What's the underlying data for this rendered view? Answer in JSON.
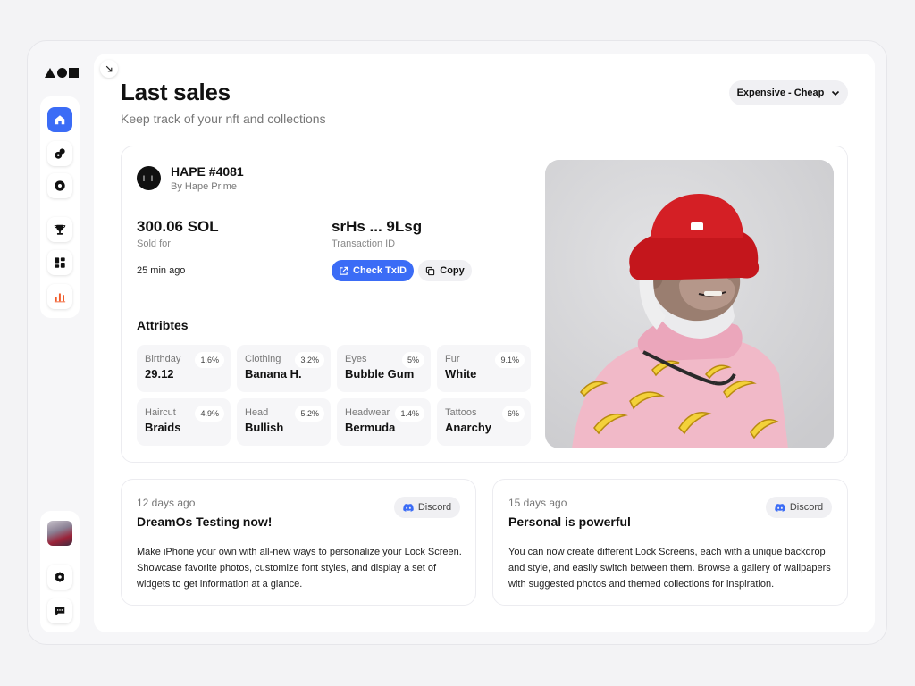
{
  "header": {
    "title": "Last sales",
    "subtitle": "Keep track of your nft and collections",
    "sort": {
      "selected": "Expensive - Cheap"
    }
  },
  "sidebar": {
    "items": [
      {
        "icon": "home-icon",
        "active": true
      },
      {
        "icon": "coins-icon",
        "active": false
      },
      {
        "icon": "disc-icon",
        "active": false
      },
      {
        "icon": "trophy-icon",
        "active": false
      },
      {
        "icon": "dashboard-icon",
        "active": false
      },
      {
        "icon": "bar-chart-icon",
        "active": false
      }
    ],
    "bottom": [
      {
        "icon": "avatar"
      },
      {
        "icon": "hexagon-settings-icon"
      },
      {
        "icon": "chat-icon"
      }
    ]
  },
  "sale": {
    "collection_logo": "I I",
    "name": "HAPE #4081",
    "by": "By Hape Prime",
    "price": "300.06 SOL",
    "price_label": "Sold for",
    "time_ago": "25 min ago",
    "tx_id": "srHs ... 9Lsg",
    "tx_label": "Transaction ID",
    "check_label": "Check TxID",
    "copy_label": "Copy",
    "attributes_heading": "Attribtes",
    "attributes": [
      {
        "name": "Birthday",
        "value": "29.12",
        "pct": "1.6%"
      },
      {
        "name": "Clothing",
        "value": "Banana H.",
        "pct": "3.2%"
      },
      {
        "name": "Eyes",
        "value": "Bubble Gum",
        "pct": "5%"
      },
      {
        "name": "Fur",
        "value": "White",
        "pct": "9.1%"
      },
      {
        "name": "Haircut",
        "value": "Braids",
        "pct": "4.9%"
      },
      {
        "name": "Head",
        "value": "Bullish",
        "pct": "5.2%"
      },
      {
        "name": "Headwear",
        "value": "Bermuda",
        "pct": "1.4%"
      },
      {
        "name": "Tattoos",
        "value": "Anarchy",
        "pct": "6%"
      }
    ]
  },
  "news": [
    {
      "date": "12 days ago",
      "title": "DreamOs Testing now!",
      "source": "Discord",
      "body": "Make iPhone your own with all-new ways to personalize your Lock Screen. Showcase favorite photos, customize font styles, and display a set of widgets to get information at a glance."
    },
    {
      "date": "15 days ago",
      "title": "Personal is powerful",
      "source": "Discord",
      "body": "You can now create different Lock Screens, each with a unique backdrop and style, and easily switch between them. Browse a gallery of wallpapers with suggested photos and themed collections for inspiration."
    }
  ],
  "colors": {
    "accent": "#3b6cf6",
    "chart_icon": "#f05a28"
  }
}
